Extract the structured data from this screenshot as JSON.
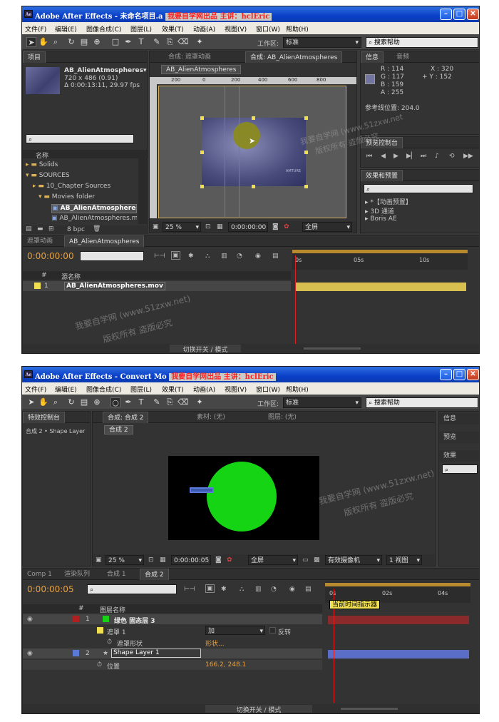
{
  "shot1": {
    "app_title": "Adobe After Effects - 未命名项目.a",
    "watermark_tag": "我要自学网出品 主讲：hclEric",
    "menu": [
      "文件(F)",
      "编辑(E)",
      "图像合成(C)",
      "图层(L)",
      "效果(T)",
      "动画(A)",
      "视图(V)",
      "窗口(W)",
      "帮助(H)"
    ],
    "workspace_label": "工作区:",
    "workspace_value": "标准",
    "search_help": "搜索帮助",
    "project": {
      "tab": "项目",
      "comp_name": "AB_AlienAtmospheres▾",
      "comp_size": "720 x 486 (0.91)",
      "comp_duration": "Δ 0:00:13:11, 29.97 fps",
      "col_name": "名称",
      "items": [
        "Solids",
        "SOURCES",
        "10_Chapter Sources",
        "Movies folder",
        "AB_AlienAtmospheres",
        "AB_AlienAtmospheres.mov"
      ],
      "bpc": "8 bpc"
    },
    "comp_panel": {
      "tab1": "合成: 遮罩动画",
      "tab2": "合成: AB_AlienAtmospheres",
      "sub_tab": "AB_AlienAtmospheres",
      "ruler": [
        "200",
        "0",
        "200",
        "400",
        "600",
        "800"
      ],
      "zoom": "25 %",
      "time": "0:00:00:00",
      "res": "全屏",
      "frame_text": "AMTURE"
    },
    "info": {
      "tab1": "信息",
      "tab2": "音频",
      "r": "R : 114",
      "g": "G : 117",
      "b": "B : 159",
      "a": "A : 255",
      "x": "X : 320",
      "y": "+ Y : 152",
      "color": "#7275a0",
      "ref": "参考线位置: 204.0"
    },
    "preview_tab": "预览控制台",
    "effects": {
      "tab": "效果和预置",
      "items": [
        "▸ *【动画预置】",
        "▸ 3D 通道",
        "▸ Boris AE"
      ]
    },
    "timeline": {
      "tab1": "遮罩动画",
      "tab2": "AB_AlienAtmospheres",
      "time": "0:00:00:00",
      "ruler": [
        "0s",
        "05s",
        "10s"
      ],
      "col_num": "#",
      "col_name": "源名称",
      "layer_num": "1",
      "layer_name": "AB_AlienAtmospheres.mov",
      "switch_label": "切换开关 / 模式"
    },
    "watermark_big1": "我要自学网 (www.51zxw.net)",
    "watermark_big2": "版权所有  盗版必究",
    "watermark_small1": "我要自学网 (www.51zxw.net",
    "watermark_small2": "版权所有  盗版必究"
  },
  "shot2": {
    "app_title": "Adobe After Effects - Convert Mo",
    "watermark_tag": "我要自学网出品 主讲：hclEric",
    "menu": [
      "文件(F)",
      "编辑(E)",
      "图像合成(C)",
      "图层(L)",
      "效果(T)",
      "动画(A)",
      "视图(V)",
      "窗口(W)",
      "帮助(H)"
    ],
    "workspace_label": "工作区:",
    "workspace_value": "标准",
    "search_help": "搜索帮助",
    "effects_ctrl_tab": "特效控制台",
    "effects_ctrl_path": "合成 2 • Shape Layer",
    "comp_tab": "合成: 合成 2",
    "material_tab": "素材: (无)",
    "layer_tab": "图层: (无)",
    "sub_tab": "合成 2",
    "zoom": "25 %",
    "time": "0:00:00:05",
    "res": "全屏",
    "camera": "有效摄像机",
    "views": "1 视图",
    "right_tabs": [
      "信息",
      "预览",
      "效果"
    ],
    "timeline": {
      "tabs": [
        "Comp 1",
        "渲染队列",
        "合成 1",
        "合成 2"
      ],
      "time": "0:00:00:05",
      "ruler": [
        "0s",
        "02s",
        "04s"
      ],
      "tooltip": "当前时间指示器",
      "col_num": "#",
      "col_name": "图层名称",
      "layers": [
        {
          "num": "1",
          "name": "绿色 固态层 3",
          "color": "#b02020"
        },
        {
          "num": "",
          "name": "遮罩 1",
          "mode": "加",
          "invert": "反转"
        },
        {
          "num": "",
          "name": "遮罩形状",
          "value": "形状..."
        },
        {
          "num": "2",
          "name": "Shape Layer 1",
          "color": "#5a7ad8"
        },
        {
          "num": "",
          "name": "位置",
          "value": "166.2, 248.1"
        }
      ],
      "switch_label": "切换开关 / 模式"
    },
    "watermark_big1": "我要自学网 (www.51zxw.net)",
    "watermark_big2": "版权所有  盗版必究"
  }
}
